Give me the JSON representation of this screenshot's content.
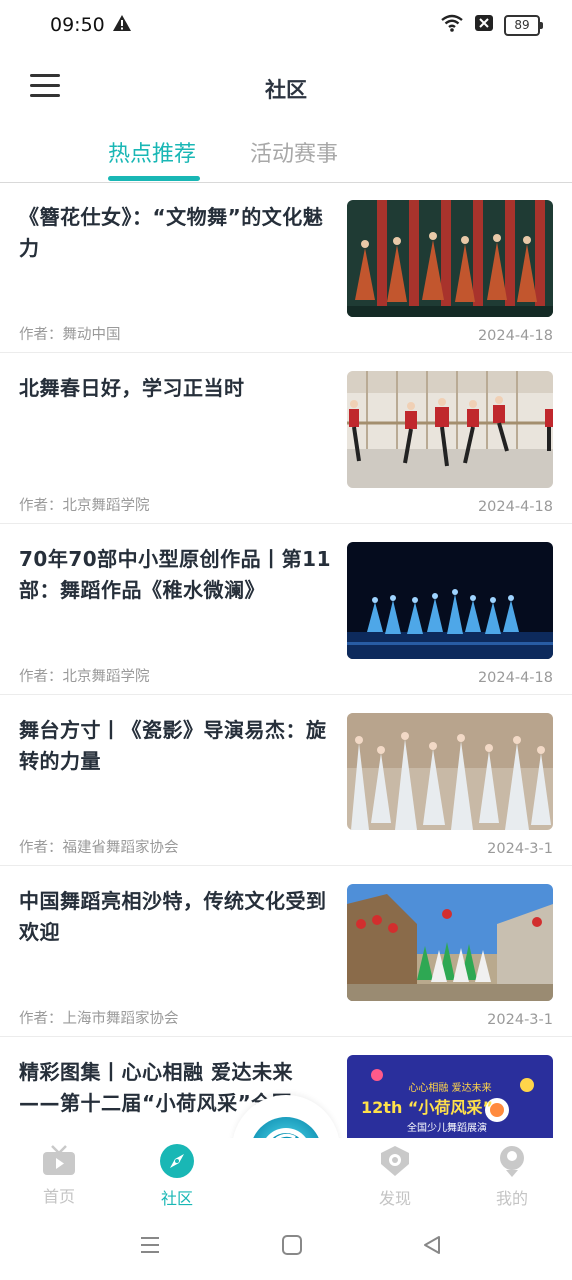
{
  "status_bar": {
    "time": "09:50",
    "battery": "89"
  },
  "header": {
    "title": "社区"
  },
  "tabs": [
    {
      "label": "热点推荐",
      "active": true
    },
    {
      "label": "活动赛事",
      "active": false
    }
  ],
  "articles": [
    {
      "title": "《簪花仕女》：“文物舞”的文化魅力",
      "author": "作者：舞动中国",
      "date": "2024-4-18",
      "thumb": "ladies-in-red-dance-photo"
    },
    {
      "title": "北舞春日好，学习正当时",
      "author": "作者：北京舞蹈学院",
      "date": "2024-4-18",
      "thumb": "dance-class-photo"
    },
    {
      "title": "70年70部中小型原创作品丨第11部：舞蹈作品《稚水微澜》",
      "author": "作者：北京舞蹈学院",
      "date": "2024-4-18",
      "thumb": "blue-stage-dance-photo"
    },
    {
      "title": "舞台方寸丨《瓷影》导演易杰：旋转的力量",
      "author": "作者：福建省舞蹈家协会",
      "date": "2024-3-1",
      "thumb": "white-dress-dancers-photo"
    },
    {
      "title": "中国舞蹈亮相沙特，传统文化受到欢迎",
      "author": "作者：上海市舞蹈家协会",
      "date": "2024-3-1",
      "thumb": "outdoor-performance-photo"
    },
    {
      "title": "精彩图集丨心心相融 爱达未来——第十二届“小荷风采”全国",
      "author": "",
      "date": "",
      "thumb": "xiaohe-poster",
      "poster": {
        "line1": "心心相融  爱达未来",
        "big": "12th “小荷风采”",
        "sub": "全国少儿舞蹈展演"
      }
    }
  ],
  "bottom_nav": [
    {
      "label": "首页",
      "icon": "tv-icon",
      "active": false
    },
    {
      "label": "社区",
      "icon": "compass-icon",
      "active": true
    },
    {
      "label": "发现",
      "icon": "discover-icon",
      "active": false
    },
    {
      "label": "我的",
      "icon": "profile-icon",
      "active": false
    }
  ],
  "colors": {
    "accent": "#19b7b5",
    "inactive": "#c4c4c4",
    "text": "#262f3a",
    "meta": "#9a9a9a"
  }
}
